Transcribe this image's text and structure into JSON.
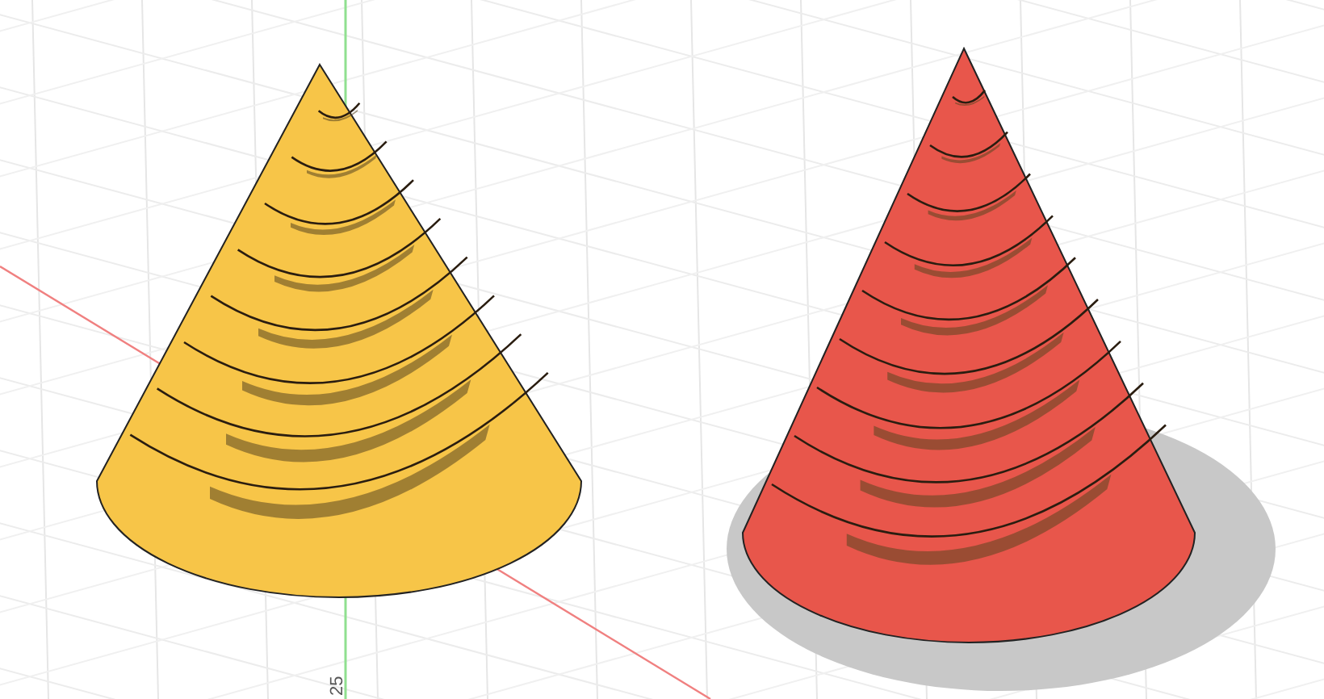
{
  "viewport": {
    "grid_labels": [
      {
        "text": "25"
      }
    ]
  },
  "models": [
    {
      "color": "#f7c548",
      "shadow": false
    },
    {
      "color": "#e8564b",
      "shadow": true
    }
  ]
}
